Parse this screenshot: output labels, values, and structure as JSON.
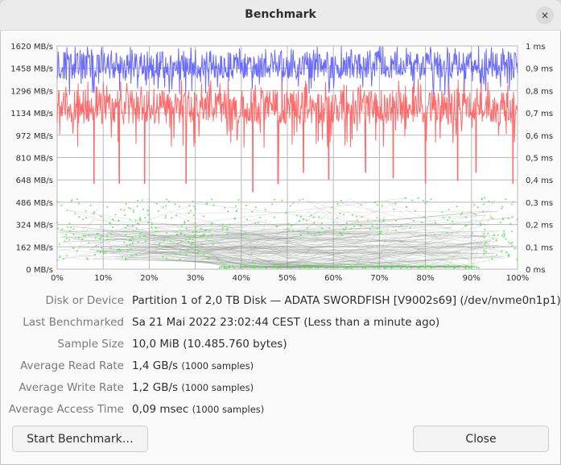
{
  "window": {
    "title": "Benchmark",
    "close_icon": "×"
  },
  "chart_data": [
    {
      "type": "line",
      "ylabel_left_ticks": [
        "1620 MB/s",
        "1458 MB/s",
        "1296 MB/s",
        "1134 MB/s",
        "972 MB/s",
        "810 MB/s",
        "648 MB/s",
        "486 MB/s",
        "324 MB/s",
        "162 MB/s",
        "0 MB/s"
      ],
      "ylabel_right_ticks": [
        "1 ms",
        "0,9 ms",
        "0,8 ms",
        "0,7 ms",
        "0,6 ms",
        "0,5 ms",
        "0,4 ms",
        "0,3 ms",
        "0,2 ms",
        "0,1 ms",
        "0 ms"
      ],
      "x_ticks": [
        "0%",
        "10%",
        "20%",
        "30%",
        "40%",
        "50%",
        "60%",
        "70%",
        "80%",
        "90%",
        "100%"
      ],
      "ylim_left": [
        0,
        1620
      ],
      "ylim_right": [
        0,
        1
      ],
      "xlim": [
        0,
        100
      ],
      "grid": true,
      "series": [
        {
          "color": "#6b6bff",
          "typical_range": [
            1380,
            1580
          ],
          "dips_to": 1260
        },
        {
          "color": "#ff6b6b",
          "typical_range": [
            1050,
            1300
          ],
          "dips": [
            {
              "x": 8,
              "y": 620
            },
            {
              "x": 13.5,
              "y": 620
            },
            {
              "x": 19,
              "y": 620
            },
            {
              "x": 28,
              "y": 620
            },
            {
              "x": 42.5,
              "y": 560
            },
            {
              "x": 48,
              "y": 620
            },
            {
              "x": 53.5,
              "y": 700
            },
            {
              "x": 59,
              "y": 650
            },
            {
              "x": 67,
              "y": 700
            },
            {
              "x": 73,
              "y": 660
            },
            {
              "x": 80,
              "y": 620
            },
            {
              "x": 87,
              "y": 640
            },
            {
              "x": 91,
              "y": 700
            },
            {
              "x": 99,
              "y": 620
            }
          ]
        }
      ],
      "access_time_points": {
        "color": "#55e055",
        "range_ms": [
          0,
          0.5
        ],
        "count": 1000
      }
    }
  ],
  "rows": [
    {
      "label": "Disk or Device",
      "value": "Partition 1 of 2,0 TB Disk — ADATA SWORDFISH [V9002s69] (/dev/nvme0n1p1)",
      "small": ""
    },
    {
      "label": "Last Benchmarked",
      "value": "Sa 21 Mai 2022 23:02:44 CEST (Less than a minute ago)",
      "small": ""
    },
    {
      "label": "Sample Size",
      "value": "10,0 MiB (10.485.760 bytes)",
      "small": ""
    },
    {
      "label": "Average Read Rate",
      "value": "1,4 GB/s",
      "small": "(1000 samples)"
    },
    {
      "label": "Average Write Rate",
      "value": "1,2 GB/s",
      "small": "(1000 samples)"
    },
    {
      "label": "Average Access Time",
      "value": "0,09 msec",
      "small": "(1000 samples)"
    }
  ],
  "buttons": {
    "start": "Start Benchmark…",
    "close": "Close"
  }
}
